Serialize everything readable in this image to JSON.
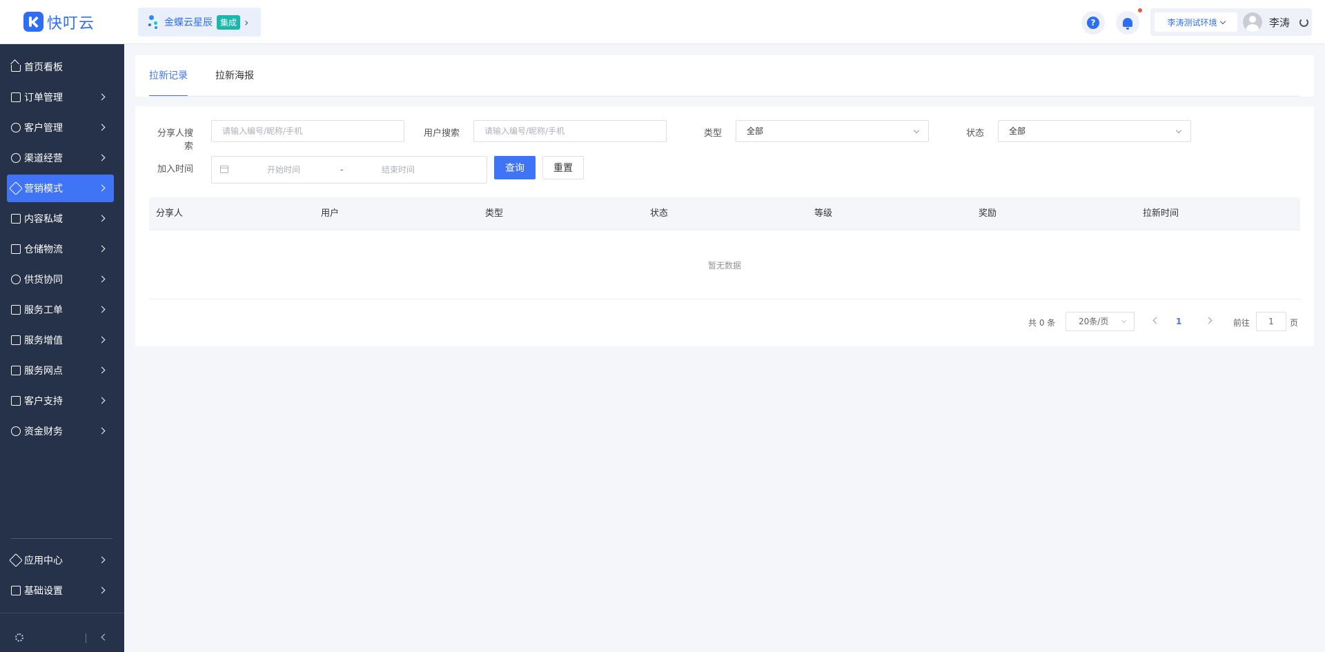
{
  "app": {
    "logo_text": "快叮云"
  },
  "integration": {
    "name": "金蝶云星辰",
    "badge": "集成",
    "arrow": "›"
  },
  "header": {
    "help_label": "?",
    "env": "李涛测试环境",
    "user": "李涛"
  },
  "sidebar": {
    "items": [
      {
        "label": "首页看板",
        "icon": "home-icon"
      },
      {
        "label": "订单管理",
        "icon": "order-icon"
      },
      {
        "label": "客户管理",
        "icon": "customer-icon"
      },
      {
        "label": "渠道经营",
        "icon": "channel-icon"
      },
      {
        "label": "营销模式",
        "icon": "marketing-icon",
        "active": true
      },
      {
        "label": "内容私域",
        "icon": "content-icon"
      },
      {
        "label": "仓储物流",
        "icon": "warehouse-icon"
      },
      {
        "label": "供货协同",
        "icon": "supply-icon"
      },
      {
        "label": "服务工单",
        "icon": "workorder-icon"
      },
      {
        "label": "服务增值",
        "icon": "value-added-icon"
      },
      {
        "label": "服务网点",
        "icon": "service-point-icon"
      },
      {
        "label": "客户支持",
        "icon": "support-icon"
      },
      {
        "label": "资金财务",
        "icon": "finance-icon"
      }
    ],
    "bottom_items": [
      {
        "label": "应用中心",
        "icon": "app-center-icon"
      },
      {
        "label": "基础设置",
        "icon": "settings-icon"
      }
    ]
  },
  "tabs": [
    {
      "label": "拉新记录",
      "active": true
    },
    {
      "label": "拉新海报",
      "active": false
    }
  ],
  "filters": {
    "sharer_label": "分享人搜索",
    "sharer_placeholder": "请输入编号/昵称/手机",
    "user_label": "用户搜索",
    "user_placeholder": "请输入编号/昵称/手机",
    "type_label": "类型",
    "type_value": "全部",
    "status_label": "状态",
    "status_value": "全部",
    "join_time_label": "加入时间",
    "start_placeholder": "开始时间",
    "date_separator": "-",
    "end_placeholder": "结束时间",
    "query_button": "查询",
    "reset_button": "重置"
  },
  "table": {
    "columns": [
      "分享人",
      "用户",
      "类型",
      "状态",
      "等级",
      "奖励",
      "拉新时间"
    ],
    "rows": [],
    "empty_text": "暂无数据"
  },
  "pagination": {
    "total_text": "共 0 条",
    "page_size": "20条/页",
    "current_page": "1",
    "goto_label": "前往",
    "goto_value": "1",
    "page_suffix": "页"
  },
  "colors": {
    "accent": "#3f74f6",
    "sidebar_bg": "#263249",
    "badge": "#1bb7ad",
    "notification_dot": "#f5533d"
  }
}
